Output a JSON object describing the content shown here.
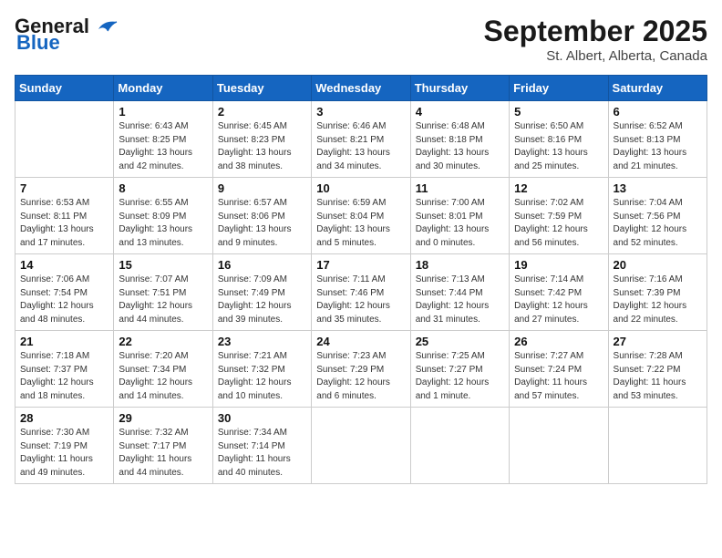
{
  "logo": {
    "line1": "General",
    "line2": "Blue"
  },
  "title": "September 2025",
  "location": "St. Albert, Alberta, Canada",
  "days_of_week": [
    "Sunday",
    "Monday",
    "Tuesday",
    "Wednesday",
    "Thursday",
    "Friday",
    "Saturday"
  ],
  "weeks": [
    [
      {
        "day": "",
        "info": ""
      },
      {
        "day": "1",
        "info": "Sunrise: 6:43 AM\nSunset: 8:25 PM\nDaylight: 13 hours\nand 42 minutes."
      },
      {
        "day": "2",
        "info": "Sunrise: 6:45 AM\nSunset: 8:23 PM\nDaylight: 13 hours\nand 38 minutes."
      },
      {
        "day": "3",
        "info": "Sunrise: 6:46 AM\nSunset: 8:21 PM\nDaylight: 13 hours\nand 34 minutes."
      },
      {
        "day": "4",
        "info": "Sunrise: 6:48 AM\nSunset: 8:18 PM\nDaylight: 13 hours\nand 30 minutes."
      },
      {
        "day": "5",
        "info": "Sunrise: 6:50 AM\nSunset: 8:16 PM\nDaylight: 13 hours\nand 25 minutes."
      },
      {
        "day": "6",
        "info": "Sunrise: 6:52 AM\nSunset: 8:13 PM\nDaylight: 13 hours\nand 21 minutes."
      }
    ],
    [
      {
        "day": "7",
        "info": "Sunrise: 6:53 AM\nSunset: 8:11 PM\nDaylight: 13 hours\nand 17 minutes."
      },
      {
        "day": "8",
        "info": "Sunrise: 6:55 AM\nSunset: 8:09 PM\nDaylight: 13 hours\nand 13 minutes."
      },
      {
        "day": "9",
        "info": "Sunrise: 6:57 AM\nSunset: 8:06 PM\nDaylight: 13 hours\nand 9 minutes."
      },
      {
        "day": "10",
        "info": "Sunrise: 6:59 AM\nSunset: 8:04 PM\nDaylight: 13 hours\nand 5 minutes."
      },
      {
        "day": "11",
        "info": "Sunrise: 7:00 AM\nSunset: 8:01 PM\nDaylight: 13 hours\nand 0 minutes."
      },
      {
        "day": "12",
        "info": "Sunrise: 7:02 AM\nSunset: 7:59 PM\nDaylight: 12 hours\nand 56 minutes."
      },
      {
        "day": "13",
        "info": "Sunrise: 7:04 AM\nSunset: 7:56 PM\nDaylight: 12 hours\nand 52 minutes."
      }
    ],
    [
      {
        "day": "14",
        "info": "Sunrise: 7:06 AM\nSunset: 7:54 PM\nDaylight: 12 hours\nand 48 minutes."
      },
      {
        "day": "15",
        "info": "Sunrise: 7:07 AM\nSunset: 7:51 PM\nDaylight: 12 hours\nand 44 minutes."
      },
      {
        "day": "16",
        "info": "Sunrise: 7:09 AM\nSunset: 7:49 PM\nDaylight: 12 hours\nand 39 minutes."
      },
      {
        "day": "17",
        "info": "Sunrise: 7:11 AM\nSunset: 7:46 PM\nDaylight: 12 hours\nand 35 minutes."
      },
      {
        "day": "18",
        "info": "Sunrise: 7:13 AM\nSunset: 7:44 PM\nDaylight: 12 hours\nand 31 minutes."
      },
      {
        "day": "19",
        "info": "Sunrise: 7:14 AM\nSunset: 7:42 PM\nDaylight: 12 hours\nand 27 minutes."
      },
      {
        "day": "20",
        "info": "Sunrise: 7:16 AM\nSunset: 7:39 PM\nDaylight: 12 hours\nand 22 minutes."
      }
    ],
    [
      {
        "day": "21",
        "info": "Sunrise: 7:18 AM\nSunset: 7:37 PM\nDaylight: 12 hours\nand 18 minutes."
      },
      {
        "day": "22",
        "info": "Sunrise: 7:20 AM\nSunset: 7:34 PM\nDaylight: 12 hours\nand 14 minutes."
      },
      {
        "day": "23",
        "info": "Sunrise: 7:21 AM\nSunset: 7:32 PM\nDaylight: 12 hours\nand 10 minutes."
      },
      {
        "day": "24",
        "info": "Sunrise: 7:23 AM\nSunset: 7:29 PM\nDaylight: 12 hours\nand 6 minutes."
      },
      {
        "day": "25",
        "info": "Sunrise: 7:25 AM\nSunset: 7:27 PM\nDaylight: 12 hours\nand 1 minute."
      },
      {
        "day": "26",
        "info": "Sunrise: 7:27 AM\nSunset: 7:24 PM\nDaylight: 11 hours\nand 57 minutes."
      },
      {
        "day": "27",
        "info": "Sunrise: 7:28 AM\nSunset: 7:22 PM\nDaylight: 11 hours\nand 53 minutes."
      }
    ],
    [
      {
        "day": "28",
        "info": "Sunrise: 7:30 AM\nSunset: 7:19 PM\nDaylight: 11 hours\nand 49 minutes."
      },
      {
        "day": "29",
        "info": "Sunrise: 7:32 AM\nSunset: 7:17 PM\nDaylight: 11 hours\nand 44 minutes."
      },
      {
        "day": "30",
        "info": "Sunrise: 7:34 AM\nSunset: 7:14 PM\nDaylight: 11 hours\nand 40 minutes."
      },
      {
        "day": "",
        "info": ""
      },
      {
        "day": "",
        "info": ""
      },
      {
        "day": "",
        "info": ""
      },
      {
        "day": "",
        "info": ""
      }
    ]
  ]
}
